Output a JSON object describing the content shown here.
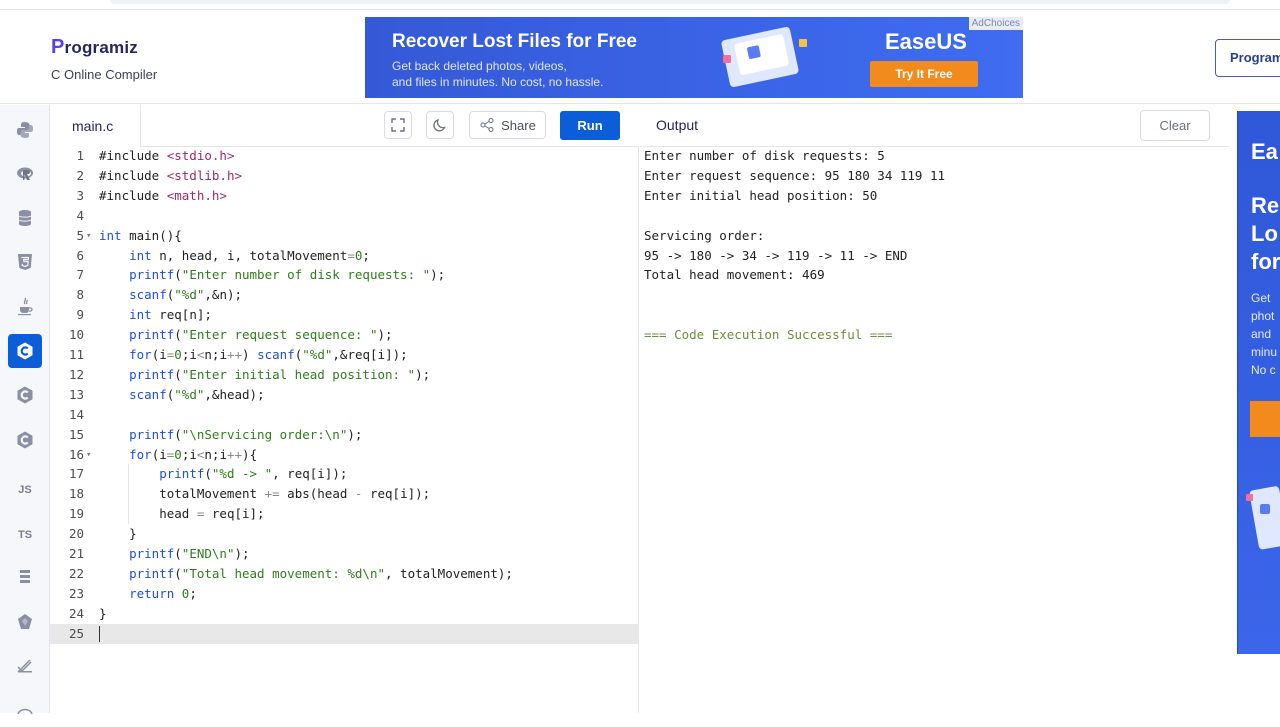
{
  "site": {
    "logo_text": "rogramiz",
    "logo_initial": "P",
    "subtitle": "C Online Compiler",
    "right_button": "Programiz PRO"
  },
  "ad_top": {
    "headline": "Recover Lost Files for Free",
    "line1": "Get back deleted photos, videos,",
    "line2": "and files in minutes. No cost, no hassle.",
    "brand": "EaseUS",
    "cta": "Try It Free",
    "adchoices": "AdChoices"
  },
  "ad_side": {
    "brand": "Ea",
    "title_lines": [
      "Re",
      "Lo",
      "for"
    ],
    "sub_lines": [
      "Get",
      "phot",
      "and",
      "minu",
      "No c"
    ]
  },
  "sidebar": {
    "items": [
      {
        "name": "python",
        "label": ""
      },
      {
        "name": "r",
        "label": ""
      },
      {
        "name": "sql",
        "label": ""
      },
      {
        "name": "html",
        "label": ""
      },
      {
        "name": "java",
        "label": ""
      },
      {
        "name": "c",
        "label": ""
      },
      {
        "name": "cpp",
        "label": ""
      },
      {
        "name": "csharp",
        "label": ""
      },
      {
        "name": "js",
        "label": "JS"
      },
      {
        "name": "ts",
        "label": "TS"
      },
      {
        "name": "go",
        "label": ""
      },
      {
        "name": "php",
        "label": ""
      },
      {
        "name": "swift",
        "label": ""
      },
      {
        "name": "rust",
        "label": ""
      }
    ]
  },
  "editor": {
    "filename": "main.c",
    "share_label": "Share",
    "run_label": "Run",
    "lines": [
      "#include <stdio.h>",
      "#include <stdlib.h>",
      "#include <math.h>",
      "",
      "int main(){",
      "    int n, head, i, totalMovement=0;",
      "    printf(\"Enter number of disk requests: \");",
      "    scanf(\"%d\",&n);",
      "    int req[n];",
      "    printf(\"Enter request sequence: \");",
      "    for(i=0;i<n;i++) scanf(\"%d\",&req[i]);",
      "    printf(\"Enter initial head position: \");",
      "    scanf(\"%d\",&head);",
      "",
      "    printf(\"\\nServicing order:\\n\");",
      "    for(i=0;i<n;i++){",
      "        printf(\"%d -> \", req[i]);",
      "        totalMovement += abs(head - req[i]);",
      "        head = req[i];",
      "    }",
      "    printf(\"END\\n\");",
      "    printf(\"Total head movement: %d\\n\", totalMovement);",
      "    return 0;",
      "}",
      ""
    ]
  },
  "output": {
    "title": "Output",
    "clear_label": "Clear",
    "lines": [
      "Enter number of disk requests: 5",
      "Enter request sequence: 95 180 34 119 11",
      "Enter initial head position: 50",
      "",
      "Servicing order:",
      "95 -> 180 -> 34 -> 119 -> 11 -> END",
      "Total head movement: 469",
      "",
      "",
      "=== Code Execution Successful ==="
    ]
  }
}
